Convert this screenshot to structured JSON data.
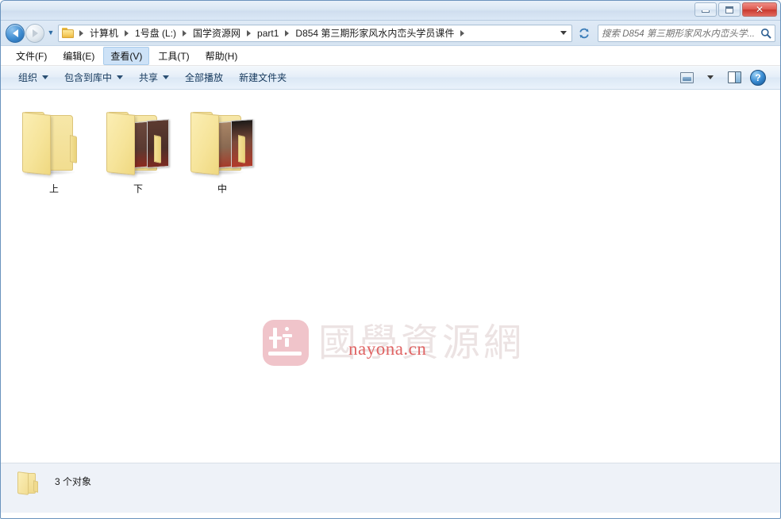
{
  "window": {
    "controls": {
      "minimize": "minimize",
      "maximize": "maximize",
      "close": "✕"
    }
  },
  "nav": {
    "back_tooltip": "后退",
    "forward_tooltip": "前进",
    "history_caret": "▼",
    "breadcrumbs": [
      "计算机",
      "1号盘 (L:)",
      "国学资源网",
      "part1",
      "D854 第三期形家风水内峦头学员课件"
    ],
    "refresh_icon": "refresh-icon"
  },
  "search": {
    "placeholder": "搜索 D854 第三期形家风水内峦头学...",
    "icon": "search-icon"
  },
  "menubar": {
    "items": [
      {
        "label": "文件(F)",
        "active": false
      },
      {
        "label": "编辑(E)",
        "active": false
      },
      {
        "label": "查看(V)",
        "active": true
      },
      {
        "label": "工具(T)",
        "active": false
      },
      {
        "label": "帮助(H)",
        "active": false
      }
    ]
  },
  "toolbar": {
    "items": [
      {
        "label": "组织",
        "has_caret": true
      },
      {
        "label": "包含到库中",
        "has_caret": true
      },
      {
        "label": "共享",
        "has_caret": true
      },
      {
        "label": "全部播放",
        "has_caret": false
      },
      {
        "label": "新建文件夹",
        "has_caret": false
      }
    ],
    "right": {
      "view_icon": "view-mode-icon",
      "view_caret": "▼",
      "preview_pane_icon": "preview-pane-icon",
      "help_icon": "help-icon",
      "help_glyph": "?"
    }
  },
  "files": {
    "items": [
      {
        "name": "上",
        "type": "folder",
        "has_thumbnails": false,
        "thumbs": []
      },
      {
        "name": "下",
        "type": "folder",
        "has_thumbnails": true,
        "thumbs": [
          "#b9c3c8",
          "#5a3a31",
          "#4b2f28"
        ]
      },
      {
        "name": "中",
        "type": "folder",
        "has_thumbnails": true,
        "thumbs": [
          "#d8d4cc",
          "#8a6a52",
          "#b33a2a"
        ]
      }
    ]
  },
  "watermark": {
    "logo_name": "guoxue-logo",
    "text": "國學資源網",
    "url": "nayona.cn",
    "text_color": "#ece3e3",
    "url_color": "#e06464",
    "logo_color": "#f0c4ca"
  },
  "statusbar": {
    "icon": "folder-icon",
    "text": "3 个对象"
  }
}
